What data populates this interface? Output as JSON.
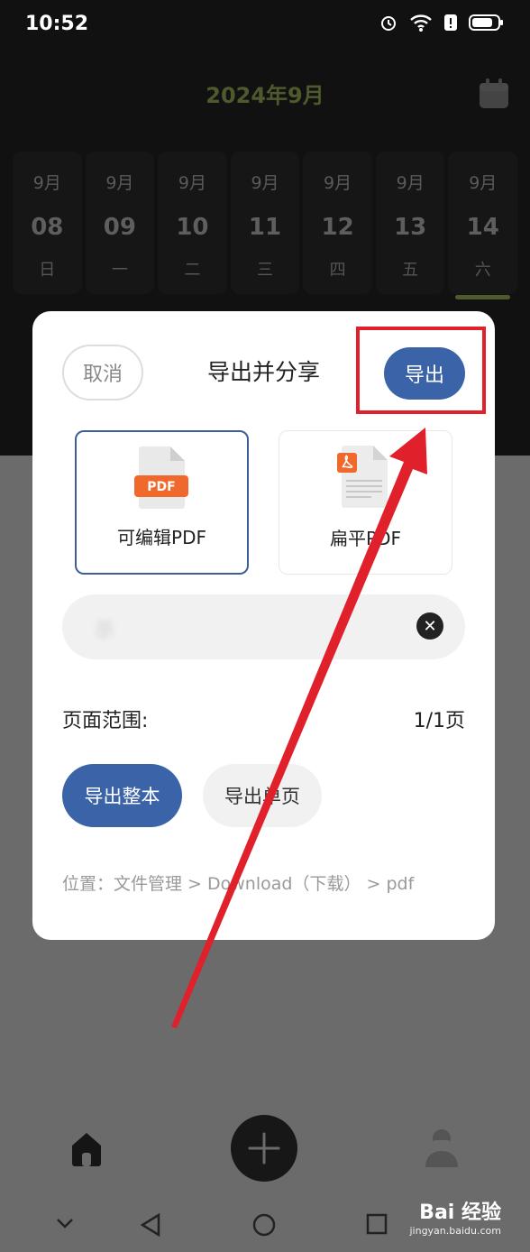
{
  "status_bar": {
    "time": "10:52",
    "icons": [
      "alarm-icon",
      "wifi-icon",
      "alert-icon",
      "battery-icon"
    ]
  },
  "calendar": {
    "month_title": "2024年9月",
    "days": [
      {
        "month": "9月",
        "day": "08",
        "weekday": "日"
      },
      {
        "month": "9月",
        "day": "09",
        "weekday": "一"
      },
      {
        "month": "9月",
        "day": "10",
        "weekday": "二"
      },
      {
        "month": "9月",
        "day": "11",
        "weekday": "三"
      },
      {
        "month": "9月",
        "day": "12",
        "weekday": "四"
      },
      {
        "month": "9月",
        "day": "13",
        "weekday": "五"
      },
      {
        "month": "9月",
        "day": "14",
        "weekday": "六"
      }
    ]
  },
  "dialog": {
    "cancel_label": "取消",
    "title": "导出并分享",
    "export_label": "导出",
    "options": {
      "editable_label": "可编辑PDF",
      "flat_label": "扁平PDF",
      "pdf_badge": "PDF"
    },
    "name_field_value": "示",
    "range_label": "页面范围:",
    "range_value": "1/1页",
    "scope_all_label": "导出整本",
    "scope_single_label": "导出单页",
    "location": "位置：文件管理 > Download（下载） > pdf"
  },
  "watermark": {
    "brand": "Bai 经验",
    "url": "jingyan.baidu.com"
  },
  "colors": {
    "accent": "#3a63a8",
    "highlight": "#e0202a",
    "month_title": "#4e5a2e"
  }
}
